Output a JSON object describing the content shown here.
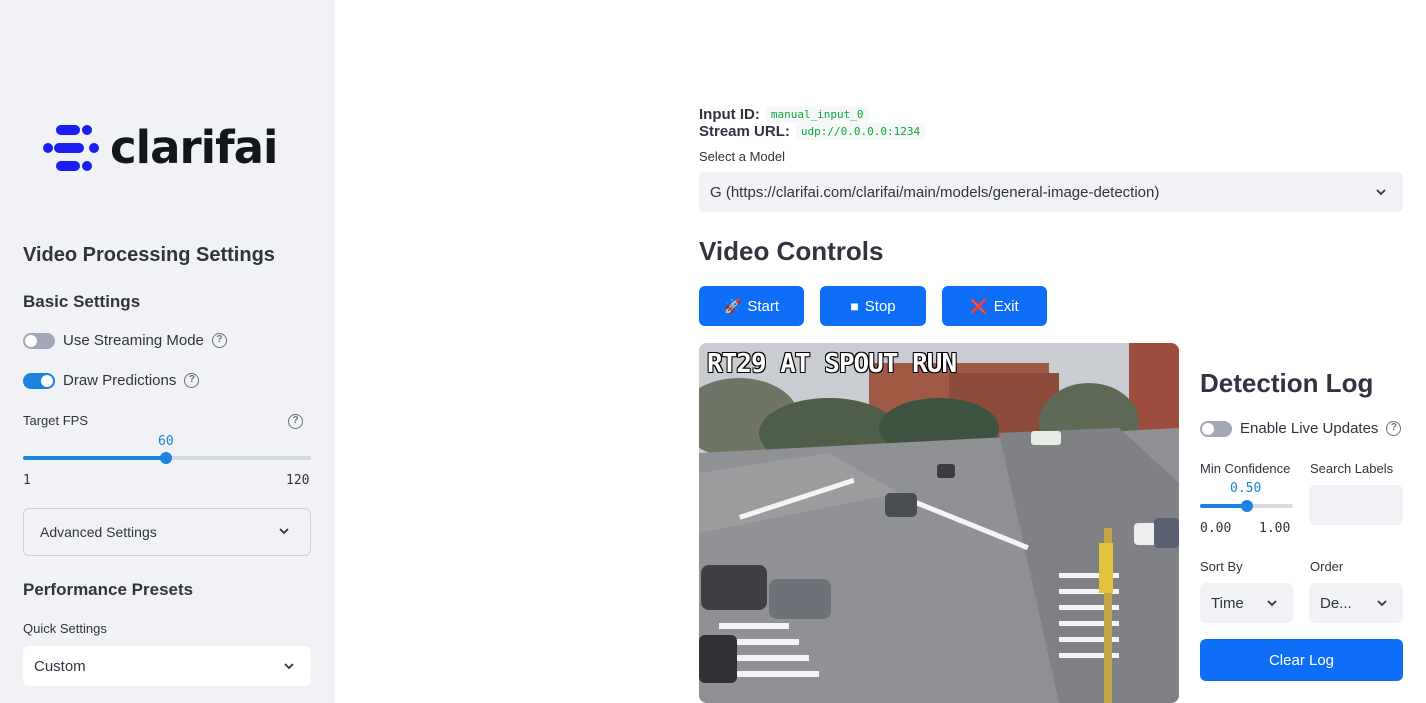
{
  "sidebar": {
    "logo_text": "clarifai",
    "brand_color": "#1a1ef0",
    "settings_title": "Video Processing Settings",
    "basic_settings": "Basic Settings",
    "use_streaming_mode": {
      "label": "Use Streaming Mode",
      "on": false
    },
    "draw_predictions": {
      "label": "Draw Predictions",
      "on": true
    },
    "target_fps": {
      "label": "Target FPS",
      "value": "60",
      "min": "1",
      "max": "120",
      "fraction": 0.504
    },
    "advanced_settings": "Advanced Settings",
    "performance_presets": "Performance Presets",
    "quick_settings": {
      "label": "Quick Settings",
      "value": "Custom"
    }
  },
  "main": {
    "input_id_label": "Input ID:",
    "input_id_value": "manual_input_0",
    "stream_url_label": "Stream URL:",
    "stream_url_value": "udp://0.0.0.0:1234",
    "select_model_label": "Select a Model",
    "select_model_value": "G (https://clarifai.com/clarifai/main/models/general-image-detection)",
    "video_controls_title": "Video Controls",
    "buttons": {
      "start": {
        "icon": "rocket-icon",
        "glyph": "🚀",
        "label": "Start"
      },
      "stop": {
        "icon": "stop-square-icon",
        "glyph": "■",
        "label": "Stop"
      },
      "exit": {
        "icon": "red-x-icon",
        "glyph": "❌",
        "label": "Exit"
      }
    },
    "video_overlay_text": "RT29 AT SPOUT RUN"
  },
  "detection_log": {
    "title": "Detection Log",
    "enable_live_updates": {
      "label": "Enable Live Updates",
      "on": false
    },
    "min_confidence": {
      "label": "Min Confidence",
      "value": "0.50",
      "min": "0.00",
      "max": "1.00",
      "fraction": 0.5
    },
    "search_labels": {
      "label": "Search Labels",
      "value": ""
    },
    "sort_by": {
      "label": "Sort By",
      "value": "Time"
    },
    "order": {
      "label": "Order",
      "value": "De..."
    },
    "clear_log": "Clear Log"
  },
  "colors": {
    "primary": "#0f6ef7",
    "accent": "#1c83e1",
    "sidebar_bg": "#f0f2f6",
    "code_green": "#09ab3b"
  }
}
